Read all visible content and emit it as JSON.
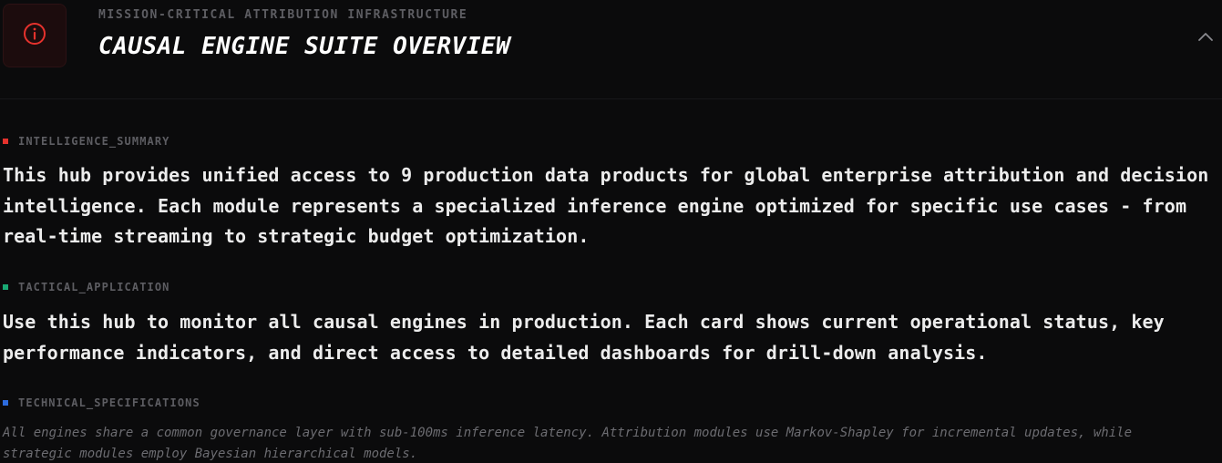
{
  "header": {
    "eyebrow": "MISSION-CRITICAL ATTRIBUTION INFRASTRUCTURE",
    "title": "CAUSAL ENGINE SUITE OVERVIEW",
    "icon": "info-circle-icon",
    "collapse_icon": "chevron-up-icon",
    "accent_color": "#e5322d"
  },
  "sections": [
    {
      "label": "INTELLIGENCE_SUMMARY",
      "marker_color": "#e5322d",
      "text": "This hub provides unified access to 9 production data products for global enterprise attribution and decision intelligence. Each module represents a specialized inference engine optimized for specific use cases - from real-time streaming to strategic budget optimization."
    },
    {
      "label": "TACTICAL_APPLICATION",
      "marker_color": "#19a974",
      "text": "Use this hub to monitor all causal engines in production. Each card shows current operational status, key performance indicators, and direct access to detailed dashboards for drill-down analysis."
    },
    {
      "label": "TECHNICAL_SPECIFICATIONS",
      "marker_color": "#2d6cdf",
      "text": "All engines share a common governance layer with sub-100ms inference latency. Attribution modules use Markov-Shapley for incremental updates, while strategic modules employ Bayesian hierarchical models."
    }
  ]
}
